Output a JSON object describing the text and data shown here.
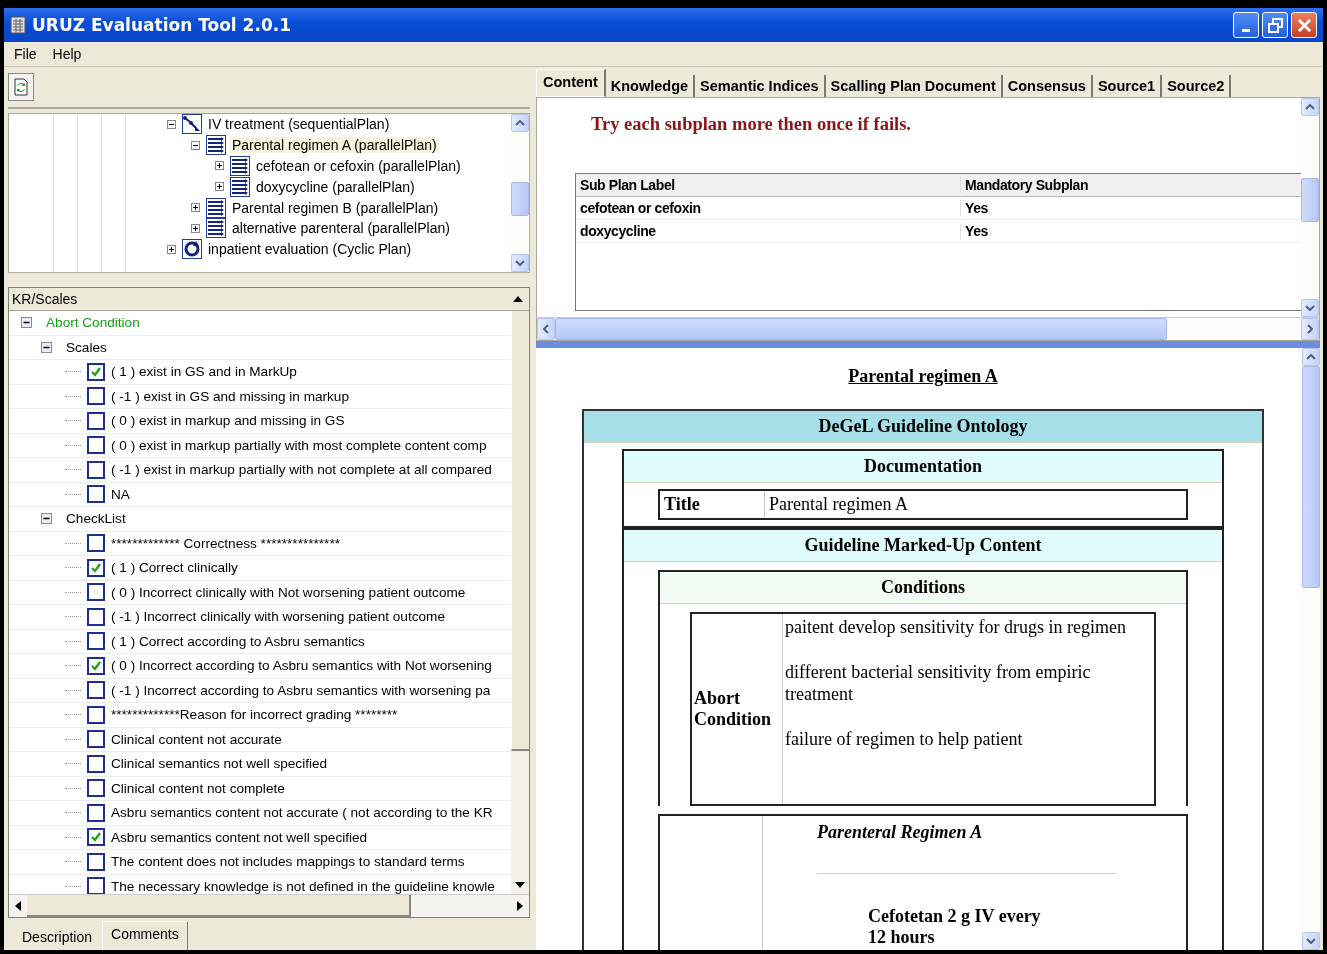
{
  "window": {
    "title": "URUZ Evaluation Tool 2.0.1"
  },
  "menu": [
    "File",
    "Help"
  ],
  "plan_tree": [
    {
      "label": "IV treatment (sequentialPlan)",
      "kind": "sequential",
      "expanded": true,
      "selected": false,
      "children": [
        {
          "label": "Parental regimen A (parallelPlan)",
          "kind": "parallel",
          "expanded": true,
          "selected": true,
          "children": [
            {
              "label": "cefotean or cefoxin (parallelPlan)",
              "kind": "parallel",
              "expanded": false,
              "selected": false
            },
            {
              "label": "doxycycline (parallelPlan)",
              "kind": "parallel",
              "expanded": false,
              "selected": false
            }
          ]
        },
        {
          "label": "Parental regimen B (parallelPlan)",
          "kind": "parallel",
          "expanded": false,
          "selected": false
        },
        {
          "label": "alternative parenteral (parallelPlan)",
          "kind": "parallel",
          "expanded": false,
          "selected": false
        }
      ]
    },
    {
      "label": "inpatient evaluation (Cyclic Plan)",
      "kind": "cyclic",
      "expanded": false,
      "selected": false
    }
  ],
  "kr_panel": {
    "header": "KR/Scales",
    "tree": [
      {
        "label": "Abort Condition",
        "kind": "condition",
        "expanded": true,
        "children": [
          {
            "label": "Scales",
            "kind": "group",
            "expanded": true,
            "children": [
              {
                "label": "( 1 ) exist in GS and in MarkUp",
                "kind": "check",
                "checked": true
              },
              {
                "label": "( -1 ) exist in GS and missing in markup",
                "kind": "check",
                "checked": false
              },
              {
                "label": "( 0 ) exist in markup and missing in GS",
                "kind": "check",
                "checked": false
              },
              {
                "label": "( 0 ) exist in markup partially with most complete content comp",
                "kind": "check",
                "checked": false
              },
              {
                "label": "( -1 ) exist in markup partially with not complete at all compared",
                "kind": "check",
                "checked": false
              },
              {
                "label": "NA",
                "kind": "check",
                "checked": false
              }
            ]
          },
          {
            "label": "CheckList",
            "kind": "group",
            "expanded": true,
            "children": [
              {
                "label": "************* Correctness ***************",
                "kind": "check",
                "checked": false
              },
              {
                "label": "( 1 ) Correct clinically",
                "kind": "check",
                "checked": true
              },
              {
                "label": "( 0 ) Incorrect clinically with Not worsening patient outcome",
                "kind": "check",
                "checked": false
              },
              {
                "label": "( -1 ) Incorrect clinically with worsening patient outcome",
                "kind": "check",
                "checked": false
              },
              {
                "label": "( 1 ) Correct according to Asbru semantics",
                "kind": "check",
                "checked": false
              },
              {
                "label": "( 0 ) Incorrect according to Asbru semantics with Not worsening",
                "kind": "check",
                "checked": true
              },
              {
                "label": "( -1 ) Incorrect according to Asbru semantics with worsening pa",
                "kind": "check",
                "checked": false
              },
              {
                "label": "*************Reason for incorrect grading ********",
                "kind": "check",
                "checked": false
              },
              {
                "label": "Clinical content not accurate",
                "kind": "check",
                "checked": false
              },
              {
                "label": "Clinical semantics not well specified",
                "kind": "check",
                "checked": false
              },
              {
                "label": "Clinical content not complete",
                "kind": "check",
                "checked": false
              },
              {
                "label": "Asbru semantics content not accurate ( not according to the KR",
                "kind": "check",
                "checked": false
              },
              {
                "label": "Asbru semantics content not well specified",
                "kind": "check",
                "checked": true
              },
              {
                "label": "The content does not includes mappings to standard terms",
                "kind": "check",
                "checked": false
              },
              {
                "label": "The necessary knowledge is not defined in the guideline knowle",
                "kind": "check",
                "checked": false
              }
            ]
          }
        ]
      }
    ]
  },
  "bottom_tabs": [
    {
      "label": "Description",
      "selected": false
    },
    {
      "label": "Comments",
      "selected": true
    }
  ],
  "tabs": [
    {
      "label": "Content",
      "selected": true
    },
    {
      "label": "Knowledge",
      "selected": false
    },
    {
      "label": "Semantic Indices",
      "selected": false
    },
    {
      "label": "Scalling Plan Document",
      "selected": false
    },
    {
      "label": "Consensus",
      "selected": false
    },
    {
      "label": "Source1",
      "selected": false
    },
    {
      "label": "Source2",
      "selected": false
    }
  ],
  "note": "Try each subplan more then once if fails.",
  "subplan_table": {
    "columns": [
      "Sub Plan Label",
      "Mandatory Subplan"
    ],
    "rows": [
      [
        "cefotean or cefoxin",
        "Yes"
      ],
      [
        "doxycycline",
        "Yes"
      ]
    ]
  },
  "document": {
    "heading": "Parental regimen A",
    "ontology_title": "DeGeL Guideline Ontology",
    "documentation": {
      "title": "Documentation",
      "fields": [
        {
          "label": "Title",
          "value": "Parental regimen A"
        }
      ]
    },
    "marked_up": {
      "title": "Guideline Marked-Up Content",
      "conditions": {
        "title": "Conditions",
        "rows": [
          {
            "label": "Abort Condition",
            "values": [
              "paitent develop sensitivity for drugs in regimen",
              "different bacterial sensitivity from empiric treatment",
              "failure of regimen to help patient"
            ]
          }
        ]
      },
      "plan_body": {
        "title": "Parenteral Regimen A",
        "steps": [
          "Cefotetan 2 g IV every 12 hours"
        ]
      }
    }
  }
}
